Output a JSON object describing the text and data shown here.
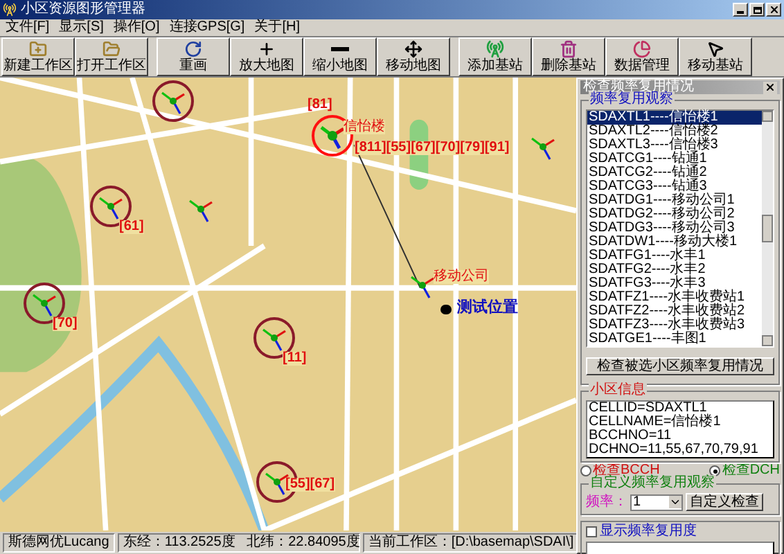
{
  "window": {
    "title": "小区资源图形管理器"
  },
  "menu": [
    "文件[F]",
    "显示[S]",
    "操作[O]",
    "连接GPS[G]",
    "关于[H]"
  ],
  "toolbar": [
    {
      "label": "新建工作区",
      "kind": "new"
    },
    {
      "label": "打开工作区",
      "kind": "open"
    },
    {
      "label": "重画",
      "kind": "redraw"
    },
    {
      "label": "放大地图",
      "kind": "zoomin"
    },
    {
      "label": "缩小地图",
      "kind": "zoomout"
    },
    {
      "label": "移动地图",
      "kind": "pan"
    },
    {
      "label": "添加基站",
      "kind": "add"
    },
    {
      "label": "删除基站",
      "kind": "delete"
    },
    {
      "label": "数据管理",
      "kind": "data"
    },
    {
      "label": "移动基站",
      "kind": "move"
    }
  ],
  "map": {
    "sites": [
      {
        "kind": "circled",
        "selected": true,
        "name": "信怡楼",
        "bcch": "[81]",
        "codes": "[811][55][67][70][79][91]"
      },
      {
        "kind": "circled",
        "selected": false,
        "codes": "[61]"
      },
      {
        "kind": "circled",
        "selected": false,
        "codes": "[70]"
      },
      {
        "kind": "circled",
        "selected": false,
        "codes": "[11]"
      },
      {
        "kind": "circled",
        "selected": false,
        "codes": "[55][67]"
      },
      {
        "kind": "plain",
        "selected": false,
        "name": "移动公司"
      },
      {
        "kind": "plain",
        "selected": false
      },
      {
        "kind": "plain",
        "selected": false
      },
      {
        "kind": "circled",
        "selected": false
      }
    ],
    "test_point": {
      "label": "测试位置"
    }
  },
  "reuse_panel": {
    "title": "检查频率复用情况",
    "list_legend": "频率复用观察",
    "items": [
      {
        "text": "SDAXTL1----信怡楼1",
        "selected": true
      },
      {
        "text": "SDAXTL2----信怡楼2",
        "selected": false
      },
      {
        "text": "SDAXTL3----信怡楼3",
        "selected": false
      },
      {
        "text": "SDATCG1----钻通1",
        "selected": false
      },
      {
        "text": "SDATCG2----钻通2",
        "selected": false
      },
      {
        "text": "SDATCG3----钻通3",
        "selected": false
      },
      {
        "text": "SDATDG1----移动公司1",
        "selected": false
      },
      {
        "text": "SDATDG2----移动公司2",
        "selected": false
      },
      {
        "text": "SDATDG3----移动公司3",
        "selected": false
      },
      {
        "text": "SDATDW1----移动大楼1",
        "selected": false
      },
      {
        "text": "SDATFG1----水丰1",
        "selected": false
      },
      {
        "text": "SDATFG2----水丰2",
        "selected": false
      },
      {
        "text": "SDATFG3----水丰3",
        "selected": false
      },
      {
        "text": "SDATFZ1----水丰收费站1",
        "selected": false
      },
      {
        "text": "SDATFZ2----水丰收费站2",
        "selected": false
      },
      {
        "text": "SDATFZ3----水丰收费站3",
        "selected": false
      },
      {
        "text": "SDATGE1----丰图1",
        "selected": false
      }
    ],
    "check_button": "检查被选小区频率复用情况",
    "cell_legend": "小区信息",
    "cell_lines": [
      "CELLID=SDAXTL1",
      "CELLNAME=信怡楼1",
      "BCCHNO=11",
      "DCHNO=11,55,67,70,79,91"
    ],
    "radios": [
      {
        "label": "检查BCCH",
        "selected": false,
        "color": "#d01010"
      },
      {
        "label": "检查DCH",
        "selected": true,
        "color": "#108010"
      }
    ],
    "custom_legend": "自定义频率复用观察",
    "freq_label": "频率：",
    "freq_value": "1",
    "custom_button": "自定义检查",
    "show_reuse": {
      "label": "显示频率复用度",
      "checked": false
    }
  },
  "status_bar": [
    "斯德网优Lucang",
    "东经：113.2525度   北纬：22.84095度",
    "当前工作区：[D:\\basemap\\SDAI\\]"
  ]
}
